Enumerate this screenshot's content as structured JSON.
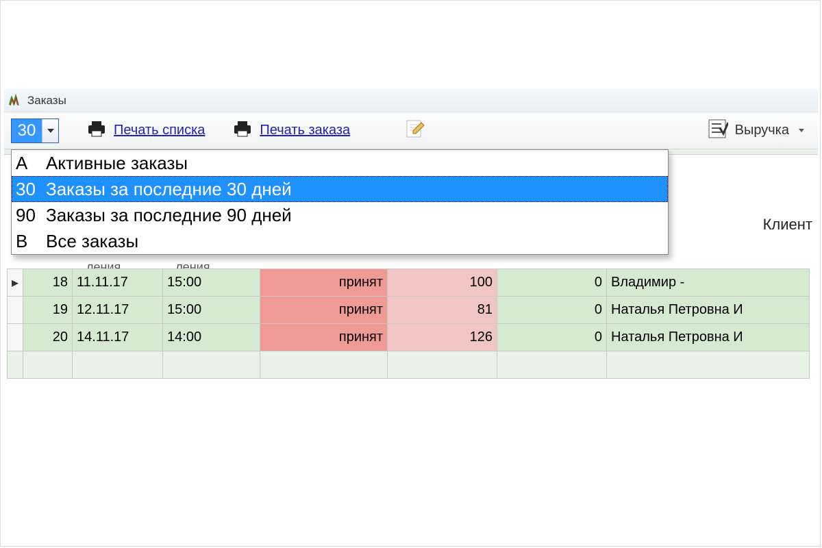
{
  "window": {
    "title": "Заказы"
  },
  "toolbar": {
    "filter_value": "30",
    "print_list": "Печать списка",
    "print_order": "Печать заказа",
    "revenue": "Выручка"
  },
  "filter_dropdown": {
    "options": [
      {
        "key": "А",
        "label": "Активные заказы",
        "selected": false
      },
      {
        "key": "30",
        "label": "Заказы за последние 30 дней",
        "selected": true
      },
      {
        "key": "90",
        "label": "Заказы за последние 90 дней",
        "selected": false
      },
      {
        "key": "В",
        "label": "Все заказы",
        "selected": false
      }
    ]
  },
  "columns": {
    "client": "Клиент",
    "partial1": "ления",
    "partial2": "ления"
  },
  "rows": [
    {
      "indicator": "▸",
      "num": "18",
      "date": "11.11.17",
      "time": "15:00",
      "status": "принят",
      "amount": "100",
      "rest": "0",
      "client": "Владимир   -"
    },
    {
      "indicator": "",
      "num": "19",
      "date": "12.11.17",
      "time": "15:00",
      "status": "принят",
      "amount": "81",
      "rest": "0",
      "client": "Наталья Петровна И"
    },
    {
      "indicator": "",
      "num": "20",
      "date": "14.11.17",
      "time": "14:00",
      "status": "принят",
      "amount": "126",
      "rest": "0",
      "client": "Наталья Петровна И"
    }
  ]
}
